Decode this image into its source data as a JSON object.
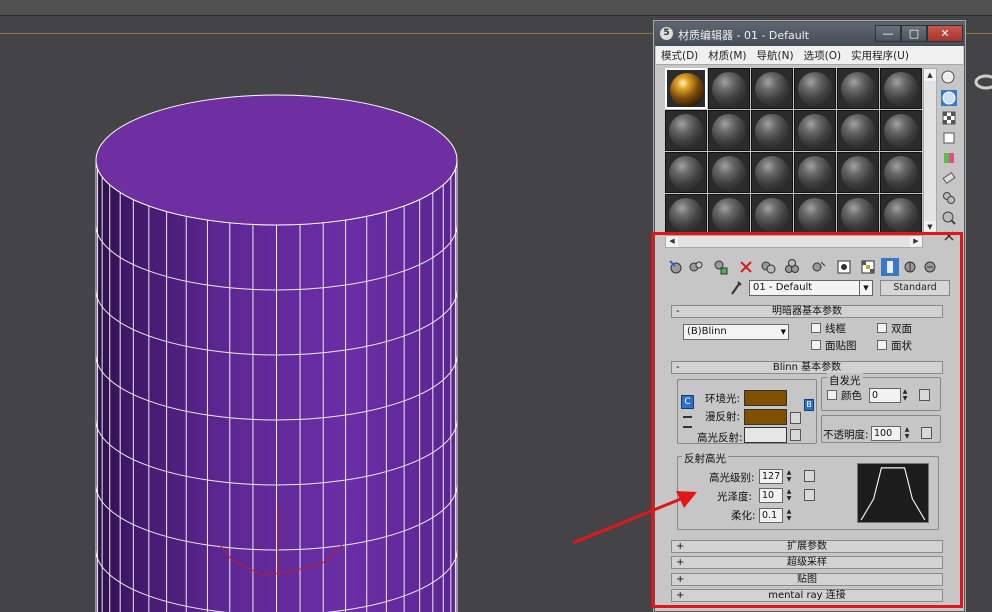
{
  "editor": {
    "title": "材质编辑器 - 01 - Default",
    "logo": "5",
    "window_buttons": {
      "minimize": "—",
      "maximize": "□",
      "close": "✕"
    },
    "menu": [
      "模式(D)",
      "材质(M)",
      "导航(N)",
      "选项(O)",
      "实用程序(U)"
    ],
    "slot_rows": 4,
    "slot_cols": 6,
    "active_slot": 0,
    "material_name": "01 - Default",
    "material_type": "Standard"
  },
  "shader_rollout": {
    "title": "明暗器基本参数",
    "sign": "-",
    "shader": "(B)Blinn",
    "options": {
      "wire": "线框",
      "two_sided": "双面",
      "face_map": "面贴图",
      "faceted": "面状"
    }
  },
  "blinn_rollout": {
    "title": "Blinn 基本参数",
    "sign": "-",
    "ambient_label": "环境光:",
    "diffuse_label": "漫反射:",
    "specular_label": "高光反射:",
    "self_illum_title": "自发光",
    "color_label": "颜色",
    "self_illum_value": "0",
    "opacity_label": "不透明度:",
    "opacity_value": "100",
    "lock_icon": "C",
    "colors": {
      "ambient": "#7f5000",
      "diffuse": "#7f5000",
      "specular": "#e6e6e6"
    }
  },
  "specular_highlights": {
    "title": "反射高光",
    "level_label": "高光级别:",
    "level_value": "127",
    "gloss_label": "光泽度:",
    "gloss_value": "10",
    "soften_label": "柔化:",
    "soften_value": "0.1"
  },
  "collapsed_rollouts": [
    {
      "sign": "+",
      "title": "扩展参数"
    },
    {
      "sign": "+",
      "title": "超级采样"
    },
    {
      "sign": "+",
      "title": "贴图"
    },
    {
      "sign": "+",
      "title": "mental ray 连接"
    }
  ],
  "viewport": {
    "object_color": "#6e2fa0",
    "annotation_color": "#e0161b"
  }
}
